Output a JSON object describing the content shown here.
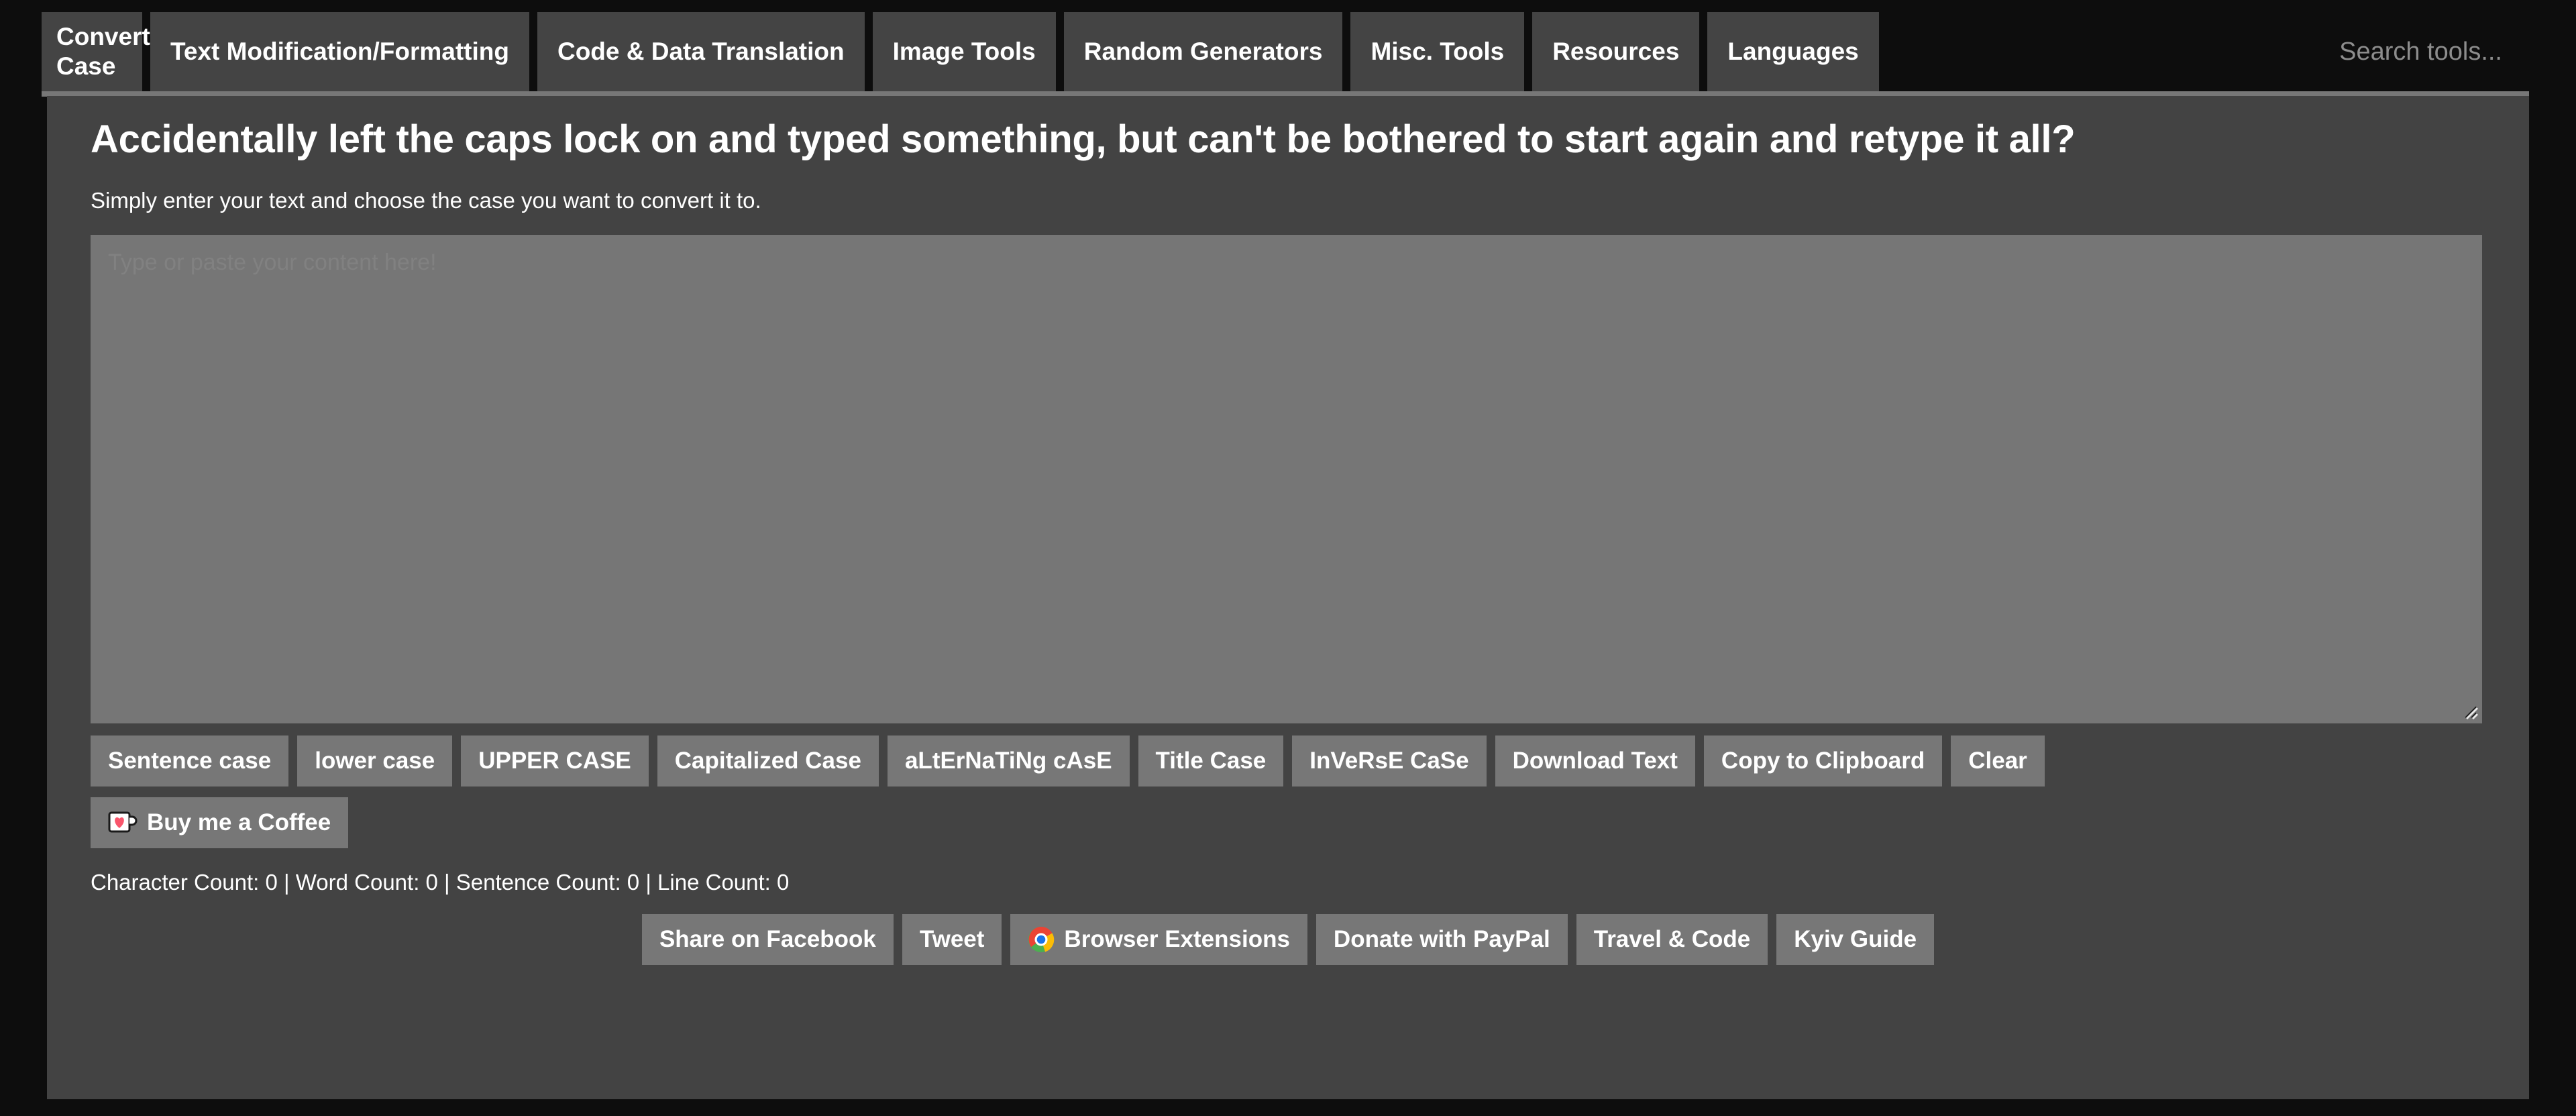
{
  "nav": {
    "tabs": [
      {
        "label": "Convert Case",
        "active": true
      },
      {
        "label": "Text Modification/Formatting",
        "active": false
      },
      {
        "label": "Code & Data Translation",
        "active": false
      },
      {
        "label": "Image Tools",
        "active": false
      },
      {
        "label": "Random Generators",
        "active": false
      },
      {
        "label": "Misc. Tools",
        "active": false
      },
      {
        "label": "Resources",
        "active": false
      },
      {
        "label": "Languages",
        "active": false
      }
    ],
    "search": {
      "value": "",
      "placeholder": "Search tools..."
    }
  },
  "main": {
    "title": "Accidentally left the caps lock on and typed something, but can't be bothered to start again and retype it all?",
    "subtitle": "Simply enter your text and choose the case you want to convert it to.",
    "textarea": {
      "value": "",
      "placeholder": "Type or paste your content here!"
    }
  },
  "actions": [
    {
      "label": "Sentence case"
    },
    {
      "label": "lower case"
    },
    {
      "label": "UPPER CASE"
    },
    {
      "label": "Capitalized Case"
    },
    {
      "label": "aLtErNaTiNg cAsE"
    },
    {
      "label": "Title Case"
    },
    {
      "label": "InVeRsE CaSe"
    },
    {
      "label": "Download Text"
    },
    {
      "label": "Copy to Clipboard"
    },
    {
      "label": "Clear"
    }
  ],
  "coffee": {
    "label": "Buy me a Coffee",
    "icon": "coffee-cup-heart-icon"
  },
  "counts": {
    "text": "Character Count: 0 | Word Count: 0 | Sentence Count: 0 | Line Count: 0",
    "character_count": 0,
    "word_count": 0,
    "sentence_count": 0,
    "line_count": 0
  },
  "footer": [
    {
      "label": "Share on Facebook",
      "icon": null
    },
    {
      "label": "Tweet",
      "icon": null
    },
    {
      "label": "Browser Extensions",
      "icon": "chrome-icon"
    },
    {
      "label": "Donate with PayPal",
      "icon": null
    },
    {
      "label": "Travel & Code",
      "icon": null
    },
    {
      "label": "Kyiv Guide",
      "icon": null
    }
  ],
  "colors": {
    "page_background": "#0d0d0d",
    "panel_background": "#434343",
    "tab_background": "#444444",
    "button_background": "#777777",
    "textarea_background": "#767676",
    "text": "#ffffff",
    "muted_text": "#8d8d8d"
  }
}
